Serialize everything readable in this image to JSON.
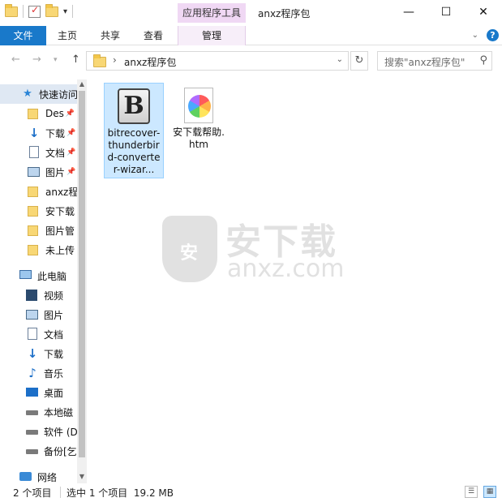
{
  "window": {
    "title": "anxz程序包",
    "contextual_tab": "应用程序工具",
    "minimize": "—",
    "maximize": "☐",
    "close": "✕"
  },
  "ribbon": {
    "file": "文件",
    "home": "主页",
    "share": "共享",
    "view": "查看",
    "manage": "管理"
  },
  "address": {
    "path": "anxz程序包",
    "search_placeholder": "搜索\"anxz程序包\""
  },
  "nav": {
    "quick_access": "快速访问",
    "items": [
      {
        "label": "Des",
        "pinned": true
      },
      {
        "label": "下载",
        "pinned": true
      },
      {
        "label": "文档",
        "pinned": true
      },
      {
        "label": "图片",
        "pinned": true
      },
      {
        "label": "anxz程"
      },
      {
        "label": "安下载"
      },
      {
        "label": "图片管"
      },
      {
        "label": "未上传"
      }
    ],
    "this_pc": "此电脑",
    "pc_items": [
      {
        "label": "视频"
      },
      {
        "label": "图片"
      },
      {
        "label": "文档"
      },
      {
        "label": "下载"
      },
      {
        "label": "音乐"
      },
      {
        "label": "桌面"
      },
      {
        "label": "本地磁"
      },
      {
        "label": "软件 (D"
      },
      {
        "label": "备份[乞"
      }
    ],
    "network": "网络"
  },
  "files": [
    {
      "name": "bitrecover-thunderbird-converter-wizar...",
      "selected": true,
      "icon": "b-app-icon"
    },
    {
      "name": "安下载帮助.htm",
      "selected": false,
      "icon": "htm-file-icon"
    }
  ],
  "watermark": {
    "cn": "安下载",
    "en": "anxz.com",
    "shield": "安"
  },
  "status": {
    "count": "2 个项目",
    "selection": "选中 1 个项目  19.2 MB"
  }
}
